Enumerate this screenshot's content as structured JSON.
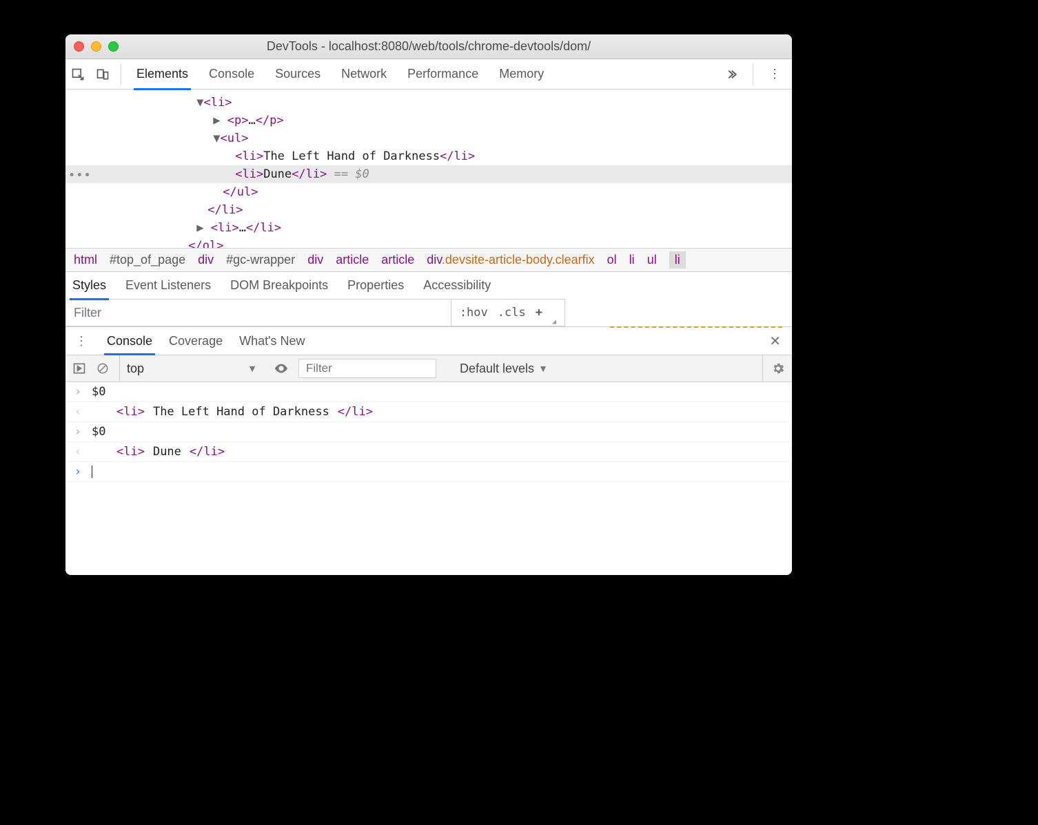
{
  "window": {
    "title": "DevTools - localhost:8080/web/tools/chrome-devtools/dom/"
  },
  "tabs": {
    "items": [
      "Elements",
      "Console",
      "Sources",
      "Network",
      "Performance",
      "Memory"
    ],
    "active": "Elements"
  },
  "dom": {
    "lines": [
      {
        "indent": 180,
        "caret": "down",
        "open": "<li>",
        "close": ""
      },
      {
        "indent": 204,
        "caret": "right",
        "open": "<p>",
        "mid": "…",
        "close": "</p>"
      },
      {
        "indent": 204,
        "caret": "down",
        "open": "<ul>",
        "close": ""
      },
      {
        "indent": 236,
        "open": "<li>",
        "text": "The Left Hand of Darkness",
        "close": "</li>"
      },
      {
        "indent": 236,
        "open": "<li>",
        "text": "Dune",
        "close": "</li>",
        "suffix": " == $0",
        "highlight": true
      },
      {
        "indent": 218,
        "open": "</ul>"
      },
      {
        "indent": 196,
        "open": "</li>"
      },
      {
        "indent": 180,
        "caret": "right",
        "open": "<li>",
        "mid": "…",
        "close": "</li>"
      },
      {
        "indent": 168,
        "open": "</ol>"
      }
    ]
  },
  "breadcrumbs": {
    "items": [
      {
        "tag": "html"
      },
      {
        "id": "#top_of_page"
      },
      {
        "tag": "div"
      },
      {
        "id": "#gc-wrapper"
      },
      {
        "tag": "div"
      },
      {
        "tag": "article"
      },
      {
        "tag": "article"
      },
      {
        "tag": "div",
        "cls": ".devsite-article-body.clearfix"
      },
      {
        "tag": "ol"
      },
      {
        "tag": "li"
      },
      {
        "tag": "ul"
      },
      {
        "tag": "li",
        "selected": true
      }
    ]
  },
  "subtabs": {
    "items": [
      "Styles",
      "Event Listeners",
      "DOM Breakpoints",
      "Properties",
      "Accessibility"
    ],
    "active": "Styles"
  },
  "styles": {
    "filter_placeholder": "Filter",
    "hov": ":hov",
    "cls": ".cls"
  },
  "drawer": {
    "tabs": [
      "Console",
      "Coverage",
      "What's New"
    ],
    "active": "Console"
  },
  "console_toolbar": {
    "context": "top",
    "filter_placeholder": "Filter",
    "levels": "Default levels"
  },
  "console": {
    "entries": [
      {
        "kind": "in",
        "text": "$0"
      },
      {
        "kind": "out",
        "tag": "li",
        "text": "The Left Hand of Darkness"
      },
      {
        "kind": "in",
        "text": "$0"
      },
      {
        "kind": "out",
        "tag": "li",
        "text": "Dune"
      }
    ]
  }
}
